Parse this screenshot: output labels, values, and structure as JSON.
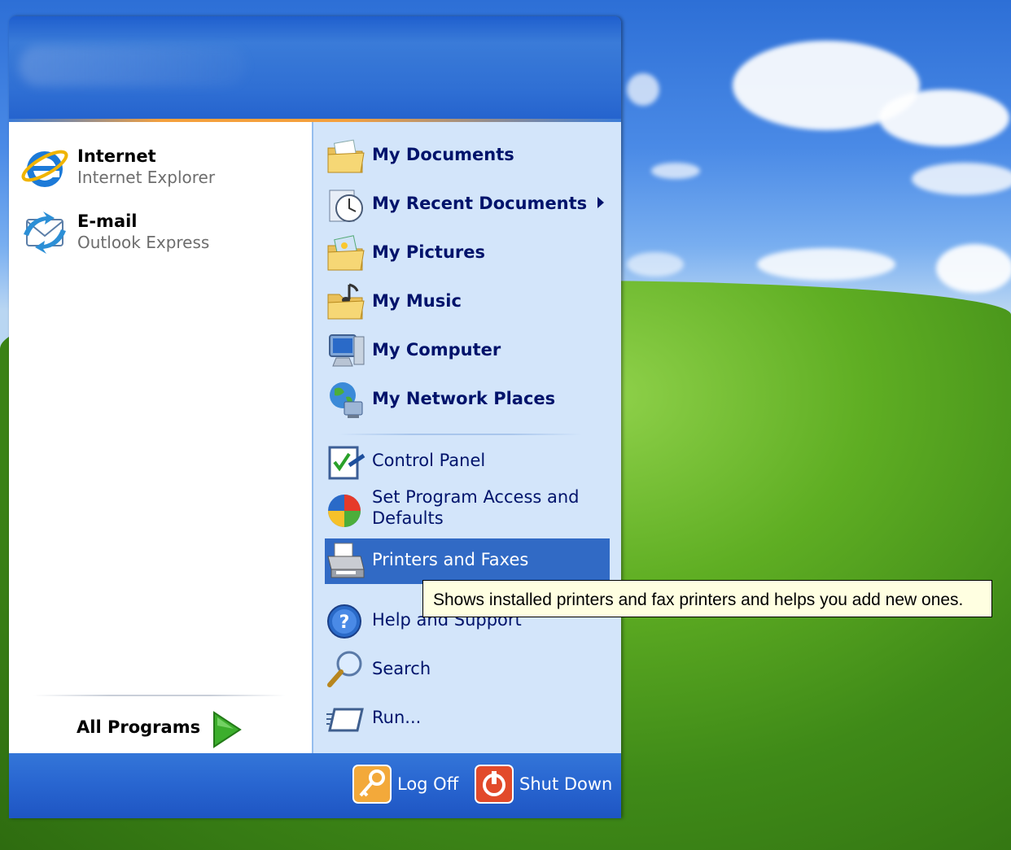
{
  "colors": {
    "menu_header": "#2f6fd4",
    "right_pane": "#d3e5fa",
    "highlight": "#316ac5",
    "tooltip_bg": "#ffffe1"
  },
  "pinned": [
    {
      "title": "Internet",
      "subtitle": "Internet Explorer",
      "icon": "internet-explorer-icon"
    },
    {
      "title": "E-mail",
      "subtitle": "Outlook Express",
      "icon": "outlook-express-icon"
    }
  ],
  "all_programs": {
    "label": "All Programs",
    "icon": "green-arrow-icon"
  },
  "places": [
    {
      "label": "My Documents",
      "icon": "my-documents-icon"
    },
    {
      "label": "My Recent Documents",
      "icon": "recent-documents-icon",
      "submenu": true
    },
    {
      "label": "My Pictures",
      "icon": "my-pictures-icon"
    },
    {
      "label": "My Music",
      "icon": "my-music-icon"
    },
    {
      "label": "My Computer",
      "icon": "my-computer-icon"
    },
    {
      "label": "My Network Places",
      "icon": "network-places-icon"
    }
  ],
  "system": [
    {
      "label": "Control Panel",
      "icon": "control-panel-icon"
    },
    {
      "label": "Set Program Access and Defaults",
      "line1": "Set Program Access and",
      "line2": "Defaults",
      "icon": "program-access-icon"
    },
    {
      "label": "Printers and Faxes",
      "icon": "printer-icon",
      "highlighted": true
    },
    {
      "label": "Help and Support",
      "icon": "help-icon"
    },
    {
      "label": "Search",
      "icon": "search-icon"
    },
    {
      "label": "Run...",
      "icon": "run-icon"
    }
  ],
  "footer": {
    "logoff": "Log Off",
    "shutdown": "Shut Down"
  },
  "tooltip": "Shows installed printers and fax printers and helps you add new ones."
}
